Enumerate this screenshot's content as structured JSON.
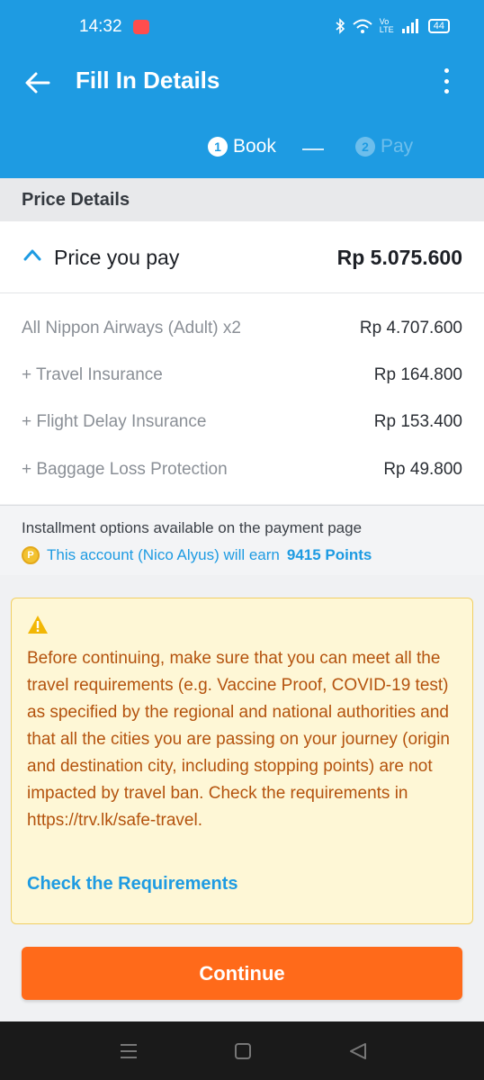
{
  "status_bar": {
    "time": "14:32",
    "battery": "44",
    "network": "Vo LTE"
  },
  "header": {
    "title": "Fill In Details"
  },
  "steps": [
    {
      "num": "1",
      "label": "Book"
    },
    {
      "num": "2",
      "label": "Pay"
    }
  ],
  "price_details": {
    "section_label": "Price Details",
    "total_label": "Price you pay",
    "total_value": "Rp 5.075.600",
    "items": [
      {
        "label": "All Nippon Airways (Adult) x2",
        "value": "Rp 4.707.600"
      },
      {
        "label": "+ Travel Insurance",
        "value": "Rp 164.800"
      },
      {
        "label": "+ Flight Delay Insurance",
        "value": "Rp 153.400"
      },
      {
        "label": "+ Baggage Loss Protection",
        "value": "Rp 49.800"
      }
    ]
  },
  "info": {
    "installment": "Installment options available on the payment page",
    "points_prefix": "This account (Nico Alyus) will earn",
    "points_value": "9415 Points"
  },
  "warning": {
    "message": "Before continuing, make sure that you can meet all the travel requirements (e.g. Vaccine Proof, COVID-19 test) as specified by the regional and national authorities and that all the cities you are passing on your journey (origin and destination city, including stopping points) are not impacted by travel ban. Check the requirements in https://trv.lk/safe-travel.",
    "link": "Check the Requirements"
  },
  "continue_label": "Continue",
  "colors": {
    "brand_blue": "#1e9be2",
    "cta_orange": "#ff6a1a",
    "warning_text": "#b4530e",
    "warning_bg": "#fef7d6"
  }
}
